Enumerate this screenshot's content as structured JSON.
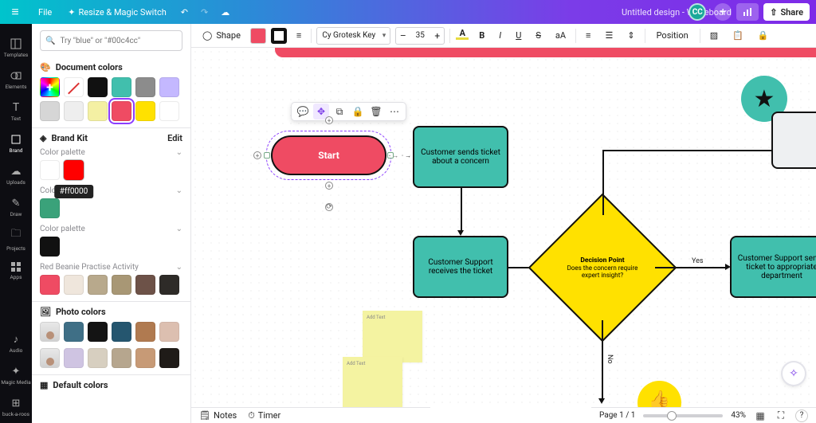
{
  "topbar": {
    "file": "File",
    "resize": "Resize & Magic Switch",
    "doc_title": "Untitled design - Whiteboard",
    "avatar": "CC",
    "share": "Share"
  },
  "rail": {
    "templates": "Templates",
    "elements": "Elements",
    "text": "Text",
    "brand": "Brand",
    "uploads": "Uploads",
    "draw": "Draw",
    "projects": "Projects",
    "apps": "Apps",
    "audio": "Audio",
    "magic": "Magic Media",
    "buck": "buck-a-roos"
  },
  "panel": {
    "search_placeholder": "Try \"blue\" or \"#00c4cc\"",
    "doc_colors_title": "Document colors",
    "brand_kit_title": "Brand Kit",
    "edit": "Edit",
    "color_palette": "Color palette",
    "tooltip_hex": "#ff0000",
    "red_beanie_title": "Red Beanie Practise Activity",
    "photo_colors_title": "Photo colors",
    "default_colors_title": "Default colors",
    "doc_swatches": [
      "add",
      "nocolor",
      "#111111",
      "#41bfad",
      "#8c8c8c",
      "#c4b8ff",
      "#d6d6d6",
      "#eeeeee",
      "#f4f0a3",
      "#ef4b63",
      "#ffe100",
      "#ffffff"
    ],
    "brand_palette1": {
      "swatches": [
        "#ffffff"
      ],
      "highlight": "#ff0000"
    },
    "brand_palette2": {
      "swatches": [
        "#3aa27a"
      ]
    },
    "brand_palette3": {
      "swatches": [
        "#111111"
      ]
    },
    "red_beanie_swatches": [
      "#ef4b63",
      "#efe6dc",
      "#b8a98c",
      "#a89775",
      "#6d5248",
      "#2e2b28"
    ],
    "photo_row1": [
      "person",
      "#3f6f86",
      "#141414",
      "#25566f",
      "#b07a50",
      "#dcbfb0"
    ],
    "photo_row2": [
      "person",
      "#cfc4e2",
      "#d7cfc0",
      "#b6a68e",
      "#c79a76",
      "#1f1b18"
    ]
  },
  "editorbar": {
    "shape": "Shape",
    "fill": "#ef4b63",
    "border_style": "border-style",
    "line_weight": "line-weight",
    "font_family": "Cy Grotesk Key",
    "font_size": "35",
    "position": "Position"
  },
  "canvas": {
    "start": "Start",
    "node_ticket": "Customer sends ticket about a concern",
    "node_support_receives": "Customer Support receives the ticket",
    "decision_title": "Decision Point",
    "decision_body": "Does the concern require expert insight?",
    "yes": "Yes",
    "no": "No",
    "node_forward": "Customer Support sends ticket to appropriate department",
    "sticky_placeholder": "Add Text",
    "float_tools": [
      "comment",
      "nudge",
      "duplicate",
      "lock",
      "delete",
      "more"
    ]
  },
  "bottom": {
    "notes": "Notes",
    "timer": "Timer",
    "page_label": "Page 1 / 1",
    "zoom": "43%"
  },
  "colors": {
    "teal": "#41bfad",
    "pink": "#ef4b63",
    "yellow": "#ffe100"
  }
}
